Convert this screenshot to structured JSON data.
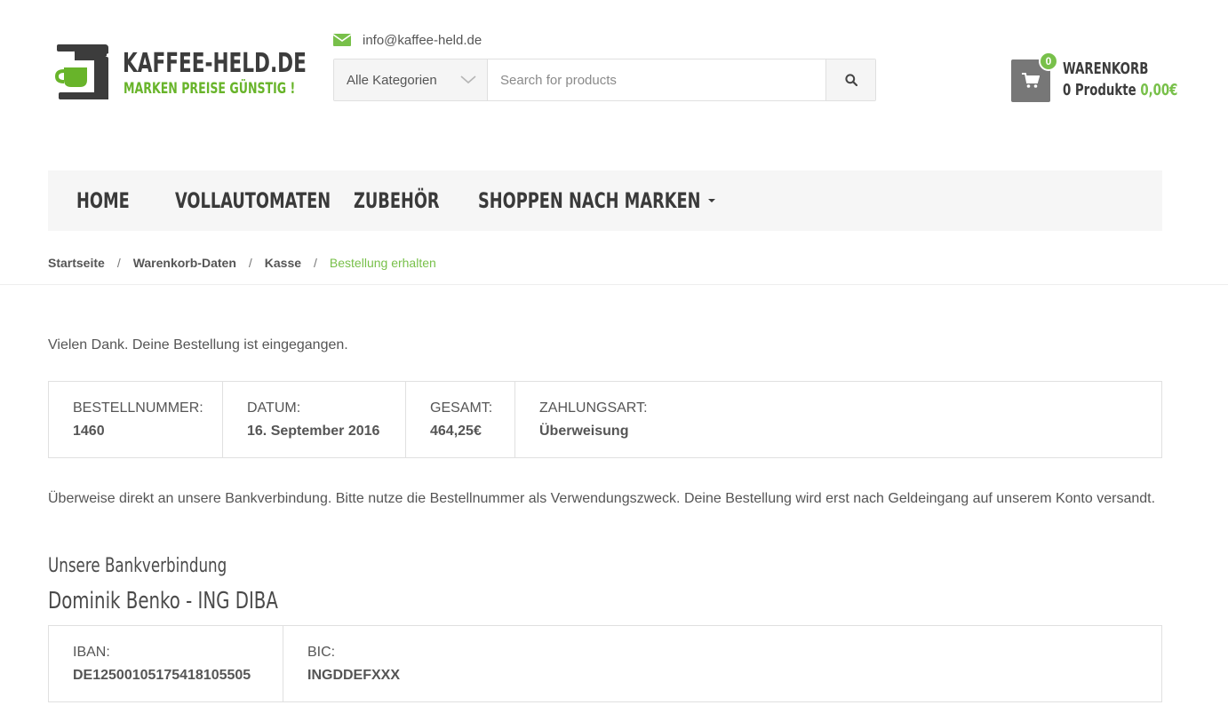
{
  "header": {
    "logo": {
      "brand": "KAFFEE-HELD.DE",
      "tagline": "MARKEN PREISE GÜNSTIG !"
    },
    "contact": {
      "icon": "envelope-icon",
      "email": "info@kaffee-held.de"
    },
    "search": {
      "category_label": "Alle Kategorien",
      "placeholder": "Search for products",
      "button_icon": "search-icon"
    },
    "cart": {
      "icon": "cart-icon",
      "badge": "0",
      "title": "WARENKORB",
      "count_label": "0 Produkte",
      "total": "0,00€",
      "accent_color": "#78c04a"
    }
  },
  "nav": {
    "items": [
      {
        "label": "HOME"
      },
      {
        "label": "VOLLAUTOMATEN"
      },
      {
        "label": "ZUBEHÖR"
      },
      {
        "label": "SHOPPEN NACH MARKEN",
        "dropdown": true
      }
    ]
  },
  "breadcrumb": {
    "items": [
      "Startseite",
      "Warenkorb-Daten",
      "Kasse"
    ],
    "current": "Bestellung erhalten",
    "separator": "/"
  },
  "order": {
    "thanks": "Vielen Dank. Deine Bestellung ist eingegangen.",
    "details": [
      {
        "label": "BESTELLNUMMER:",
        "value": "1460"
      },
      {
        "label": "DATUM:",
        "value": "16. September 2016"
      },
      {
        "label": "GESAMT:",
        "value": "464,25€"
      },
      {
        "label": "ZAHLUNGSART:",
        "value": "Überweisung"
      }
    ],
    "note": "Überweise direkt an unsere Bankverbindung. Bitte nutze die Bestellnummer als Verwendungszweck. Deine Bestellung wird erst nach Geldeingang auf unserem Konto versandt."
  },
  "bank": {
    "heading": "Unsere Bankverbindung",
    "holder": "Dominik Benko - ING DIBA",
    "details": [
      {
        "label": "IBAN:",
        "value": "DE12500105175418105505"
      },
      {
        "label": "BIC:",
        "value": "INGDDEFXXX"
      }
    ]
  },
  "colors": {
    "accent": "#78c04a",
    "text": "#555555",
    "nav_bg": "#f6f6f6",
    "border": "#e0e0e0"
  }
}
